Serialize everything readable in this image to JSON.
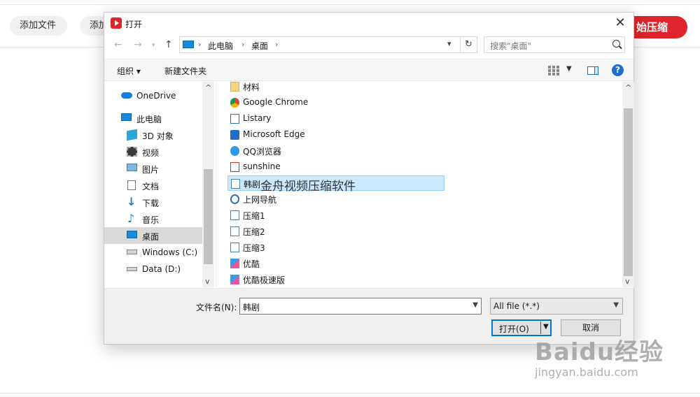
{
  "app": {
    "add_file_1": "添加文件",
    "add_file_2": "添加",
    "start_button": "始压缩",
    "accent_color": "#e0242b"
  },
  "dialog": {
    "title": "打开",
    "nav": {
      "back": "←",
      "forward": "→",
      "up": "↑",
      "breadcrumb": [
        "此电脑",
        "桌面"
      ],
      "search_placeholder": "搜索\"桌面\""
    },
    "toolbar": {
      "organize": "组织 ▾",
      "new_folder": "新建文件夹"
    },
    "sidebar": {
      "items": [
        {
          "label": "OneDrive",
          "icon": "cloud-icon"
        },
        {
          "label": "此电脑",
          "icon": "computer-icon"
        },
        {
          "label": "3D 对象",
          "icon": "cube-icon"
        },
        {
          "label": "视频",
          "icon": "video-icon"
        },
        {
          "label": "图片",
          "icon": "picture-icon"
        },
        {
          "label": "文档",
          "icon": "document-icon"
        },
        {
          "label": "下载",
          "icon": "download-icon"
        },
        {
          "label": "音乐",
          "icon": "music-icon"
        },
        {
          "label": "桌面",
          "icon": "desktop-icon",
          "selected": true
        },
        {
          "label": "Windows (C:)",
          "icon": "drive-icon"
        },
        {
          "label": "Data (D:)",
          "icon": "drive-icon"
        }
      ]
    },
    "files": [
      {
        "name": "材料",
        "icon": "folder-icon"
      },
      {
        "name": "Google Chrome",
        "icon": "chrome-icon"
      },
      {
        "name": "Listary",
        "icon": "shortcut-icon"
      },
      {
        "name": "Microsoft Edge",
        "icon": "edge-icon"
      },
      {
        "name": "QQ浏览器",
        "icon": "qq-browser-icon"
      },
      {
        "name": "sunshine",
        "icon": "pdf-icon"
      },
      {
        "name": "韩剧",
        "icon": "video-file-icon",
        "selected": true,
        "tooltip": "金舟视频压缩软件"
      },
      {
        "name": "上网导航",
        "icon": "shortcut-icon"
      },
      {
        "name": "压缩1",
        "icon": "image-file-icon"
      },
      {
        "name": "压缩2",
        "icon": "image-file-icon"
      },
      {
        "name": "压缩3",
        "icon": "image-file-icon"
      },
      {
        "name": "优酷",
        "icon": "youku-icon"
      },
      {
        "name": "优酷极速版",
        "icon": "youku-icon"
      }
    ],
    "bottom": {
      "filename_label": "文件名(N):",
      "filename_value": "韩剧",
      "filter_value": "All file (*.*)",
      "open_label": "打开(O)",
      "cancel_label": "取消"
    }
  },
  "watermark": {
    "logo": "Baidu经验",
    "url": "jingyan.baidu.com"
  }
}
